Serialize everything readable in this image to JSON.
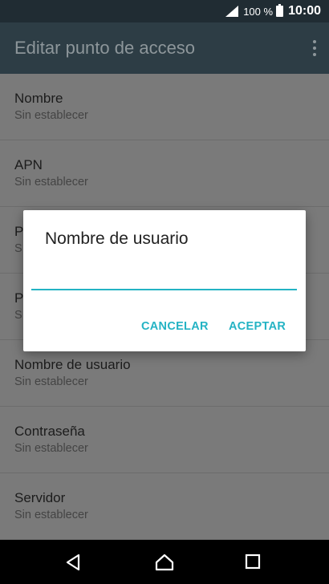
{
  "status_bar": {
    "battery_percent": "100 %",
    "time": "10:00",
    "icons": [
      "signal-icon",
      "battery-icon"
    ]
  },
  "app_bar": {
    "title": "Editar punto de acceso",
    "menu_icon": "overflow-menu-icon"
  },
  "list": [
    {
      "title": "Nombre",
      "subtitle": "Sin establecer"
    },
    {
      "title": "APN",
      "subtitle": "Sin establecer"
    },
    {
      "title": "P",
      "subtitle": "S"
    },
    {
      "title": "P",
      "subtitle": "S"
    },
    {
      "title": "Nombre de usuario",
      "subtitle": "Sin establecer"
    },
    {
      "title": "Contraseña",
      "subtitle": "Sin establecer"
    },
    {
      "title": "Servidor",
      "subtitle": "Sin establecer"
    }
  ],
  "dialog": {
    "title": "Nombre de usuario",
    "input_value": "",
    "cancel_label": "CANCELAR",
    "accept_label": "ACEPTAR"
  },
  "nav_bar": {
    "icons": [
      "back-icon",
      "home-icon",
      "recents-icon"
    ]
  },
  "colors": {
    "accent": "#24b3c4",
    "app_bar": "#2d3d45",
    "status_bar": "#202c33"
  }
}
